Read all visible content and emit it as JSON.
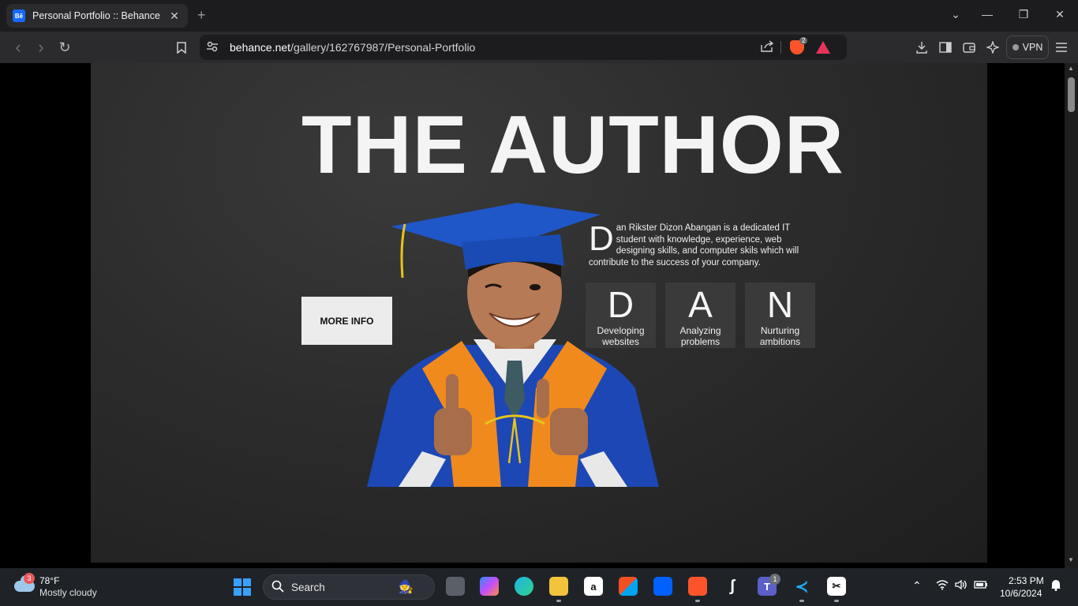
{
  "tab": {
    "favicon": "Bē",
    "title": "Personal Portfolio :: Behance",
    "close": "✕",
    "new_tab": "+"
  },
  "window": {
    "dropdown": "⌄",
    "minimize": "—",
    "restore": "❐",
    "close": "✕"
  },
  "toolbar": {
    "back": "‹",
    "forward": "›",
    "reload": "↻",
    "bookmark": "🔖",
    "url_host": "behance.net",
    "url_path": "/gallery/162767987/Personal-Portfolio",
    "shields_count": "2",
    "vpn_label": "VPN"
  },
  "page": {
    "headline": "THE AUTHOR",
    "more_info": "MORE INFO",
    "bio_drop_cap": "D",
    "bio_text": "an Rikster Dizon Abangan is a dedicated IT student with knowledge, experience, web designing skills, and computer skils which will contribute to the success of your company.",
    "letters": [
      {
        "letter": "D",
        "caption_line1": "Developing",
        "caption_line2": "websites"
      },
      {
        "letter": "A",
        "caption_line1": "Analyzing",
        "caption_line2": "problems"
      },
      {
        "letter": "N",
        "caption_line1": "Nurturing",
        "caption_line2": "ambitions"
      }
    ],
    "colors": {
      "cap_blue": "#1f56c8",
      "gown_blue": "#1c47b5",
      "stole_orange": "#f08a1c",
      "tassel_yellow": "#e7c41a",
      "skin": "#b77a56"
    }
  },
  "taskbar": {
    "weather_badge": "3",
    "weather_temp": "78°F",
    "weather_desc": "Mostly cloudy",
    "search_label": "Search",
    "teams_badge": "1",
    "time": "2:53 PM",
    "date": "10/6/2024",
    "apps": [
      "task-view-icon",
      "copilot-icon",
      "edge-icon",
      "file-explorer-icon",
      "amazon-icon",
      "microsoft-store-icon",
      "dropbox-icon",
      "brave-icon",
      "capcut-app-icon",
      "teams-icon",
      "vscode-icon",
      "capcut-icon"
    ]
  }
}
